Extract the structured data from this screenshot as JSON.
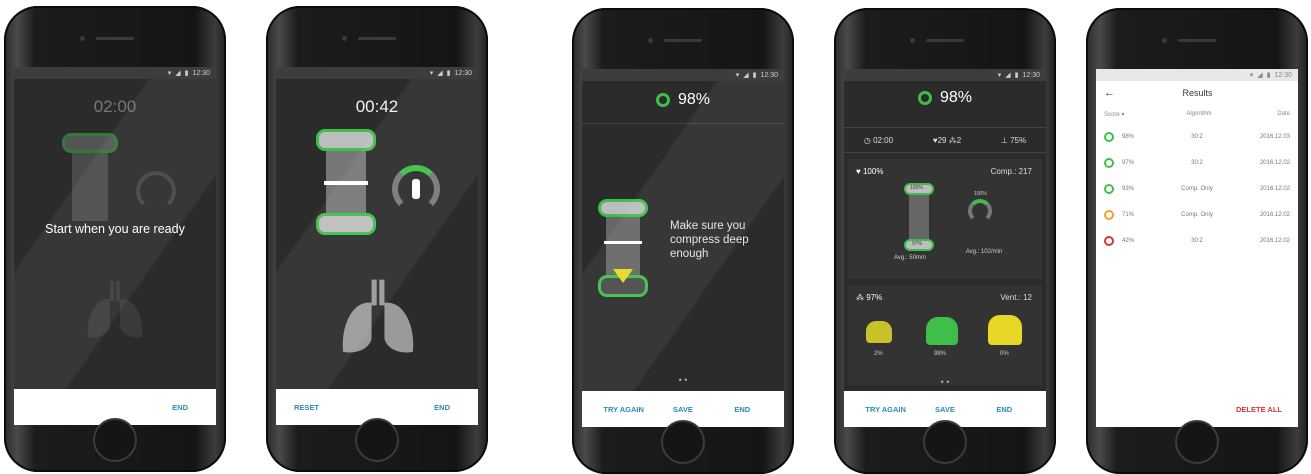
{
  "status_time": "12:30",
  "screen1": {
    "timer": "02:00",
    "message": "Start when you are ready",
    "end_label": "END"
  },
  "screen2": {
    "timer": "00:42",
    "reset_label": "RESET",
    "end_label": "END"
  },
  "screen3": {
    "score": "98%",
    "message": "Make sure you compress deep enough",
    "try_again_label": "TRY AGAIN",
    "save_label": "SAVE",
    "end_label": "END"
  },
  "screen4": {
    "score": "98%",
    "duration": "02:00",
    "heart_count": "29",
    "lungs_count": "2",
    "push_pct": "75%",
    "heart_pct": "100%",
    "comp_label": "Comp.: 217",
    "depth_top": "100%",
    "depth_bottom": "97%",
    "avg_depth": "Avg.: 50mm",
    "rate_pct": "100%",
    "avg_rate": "Avg.: 102/min",
    "lungs_pct": "97%",
    "vent_label": "Vent.: 12",
    "lung_values": [
      "2%",
      "98%",
      "0%"
    ],
    "try_again_label": "TRY AGAIN",
    "save_label": "SAVE",
    "end_label": "END"
  },
  "screen5": {
    "title": "Results",
    "columns": [
      "Score",
      "Algorithm",
      "Date"
    ],
    "rows": [
      {
        "score": "98%",
        "algorithm": "30:2",
        "date": "2016.12.03",
        "color": "#3fbf4a"
      },
      {
        "score": "97%",
        "algorithm": "30:2",
        "date": "2016.12.02",
        "color": "#3fbf4a"
      },
      {
        "score": "93%",
        "algorithm": "Comp. Only",
        "date": "2016.12.02",
        "color": "#3fbf4a"
      },
      {
        "score": "71%",
        "algorithm": "Comp. Only",
        "date": "2016.12.02",
        "color": "#f0a030"
      },
      {
        "score": "42%",
        "algorithm": "30:2",
        "date": "2016.12.02",
        "color": "#d9343a"
      }
    ],
    "delete_all_label": "DELETE ALL"
  },
  "colors": {
    "accent_green": "#3fbf4a",
    "link_blue": "#2e8ab5",
    "delete_red": "#d9343a",
    "warn_yellow": "#e8d825"
  }
}
